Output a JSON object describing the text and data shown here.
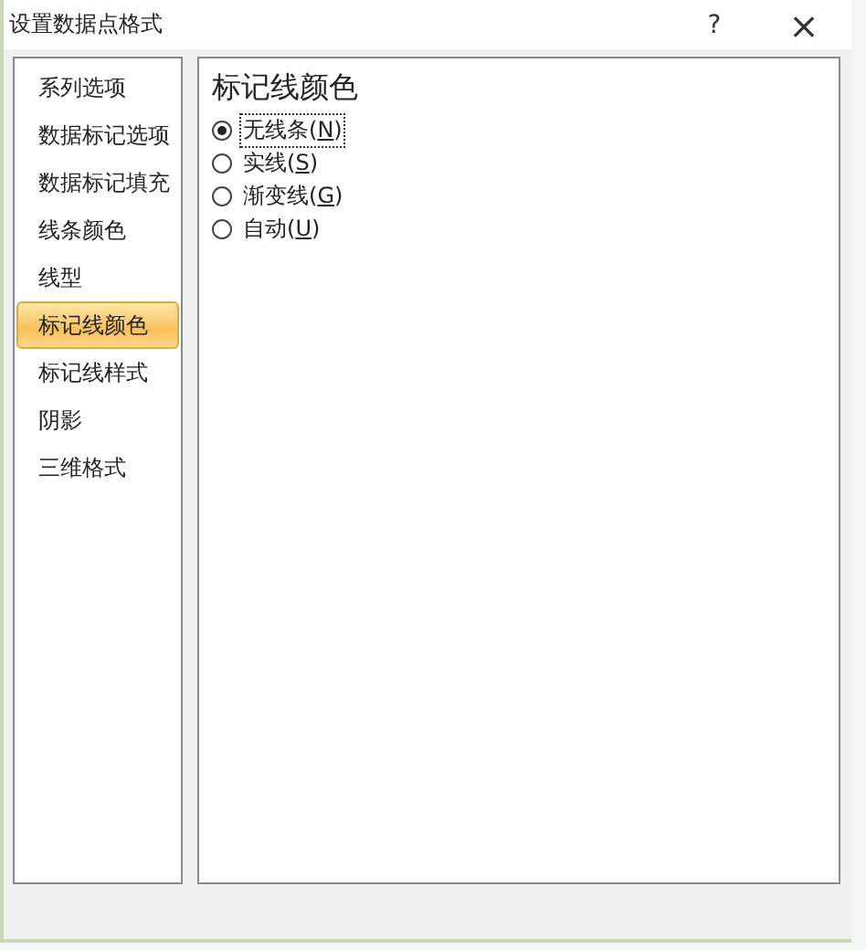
{
  "window": {
    "title": "设置数据点格式",
    "help": "?",
    "close": "×"
  },
  "sidebar": {
    "items": [
      {
        "label": "系列选项",
        "selected": false
      },
      {
        "label": "数据标记选项",
        "selected": false
      },
      {
        "label": "数据标记填充",
        "selected": false
      },
      {
        "label": "线条颜色",
        "selected": false
      },
      {
        "label": "线型",
        "selected": false
      },
      {
        "label": "标记线颜色",
        "selected": true
      },
      {
        "label": "标记线样式",
        "selected": false
      },
      {
        "label": "阴影",
        "selected": false
      },
      {
        "label": "三维格式",
        "selected": false
      }
    ]
  },
  "panel": {
    "heading": "标记线颜色",
    "options": [
      {
        "label": "无线条(",
        "key": "N",
        "after": ")",
        "selected": true
      },
      {
        "label": "实线(",
        "key": "S",
        "after": ")",
        "selected": false
      },
      {
        "label": "渐变线(",
        "key": "G",
        "after": ")",
        "selected": false
      },
      {
        "label": "自动(",
        "key": "U",
        "after": ")",
        "selected": false
      }
    ]
  }
}
